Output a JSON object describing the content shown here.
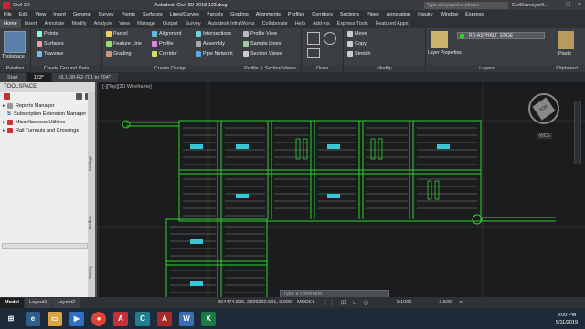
{
  "app": {
    "title": "Autodesk Civil 3D 2018   123.dwg",
    "product": "Civil 3D",
    "search_placeholder": "Type a keyword or phrase",
    "user": "CivilSurveyor0..."
  },
  "menu": [
    "File",
    "Edit",
    "View",
    "Insert",
    "General",
    "Survey",
    "Points",
    "Surfaces",
    "Lines/Curves",
    "Parcels",
    "Grading",
    "Alignments",
    "Profiles",
    "Corridors",
    "Sections",
    "Pipes",
    "Annotation",
    "Inquiry",
    "Window",
    "Express"
  ],
  "ribbon_tabs": [
    "Home",
    "Insert",
    "Annotate",
    "Modify",
    "Analyze",
    "View",
    "Manage",
    "Output",
    "Survey",
    "Autodesk InfraWorks",
    "Collaborate",
    "Help",
    "Add-ins",
    "Express Tools",
    "Featured Apps"
  ],
  "ribbon": {
    "toolspace": "Toolspace",
    "palettes": "Palettes",
    "ground_data": [
      "Points",
      "Surfaces",
      "Traverse"
    ],
    "ground_data_label": "Create Ground Data",
    "design_col1": [
      "Parcel",
      "Feature Line",
      "Grading"
    ],
    "design_col2": [
      "Alignment",
      "Profile",
      "Corridor"
    ],
    "design_col3": [
      "Intersections",
      "Assembly",
      "Pipe Network"
    ],
    "design_label": "Create Design",
    "profile_section": [
      "Profile View",
      "Sample Lines",
      "Section Views"
    ],
    "profile_section_label": "Profile & Section Views",
    "draw_label": "Draw",
    "modify_items": [
      "Move",
      "Copy",
      "Stretch"
    ],
    "modify_label": "Modify",
    "layer_properties": "Layer Properties",
    "layer_current": "RD-ASPHALT_EDGE",
    "layers_label": "Layers",
    "paste": "Paste",
    "clipboard_label": "Clipboard"
  },
  "doc_tabs": [
    "Start",
    "123*",
    "0L1-38-R2-701 to 704*"
  ],
  "toolspace": {
    "title": "TOOLSPACE",
    "items": [
      "Reports Manager",
      "Subscription Extension Manager",
      "Miscellaneous Utilities",
      "Rail Turnouts and Crossings"
    ],
    "vertical_tabs": [
      "Settings",
      "Toolbox",
      "Survey"
    ]
  },
  "viewport": {
    "label": "[-][Top][2D Wireframe]",
    "compass": "TOP",
    "wcs": "WCS"
  },
  "command": {
    "placeholder": "Type a command"
  },
  "status": {
    "layout_tabs": [
      "Model",
      "Layout1",
      "Layout2"
    ],
    "coords": "364474.896, 2929222.921, 0.000",
    "model": "MODEL",
    "scale": "1:1000",
    "elevation": "3.500"
  },
  "taskbar": {
    "time": "9:00 PM",
    "date": "5/11/2019"
  },
  "colors": {
    "road_green": "#2fd02f",
    "lot_gray": "#b9b9b9",
    "accent": "#2d6fb0"
  }
}
